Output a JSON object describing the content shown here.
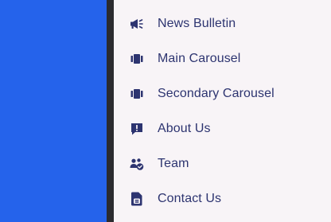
{
  "menu": {
    "items": [
      {
        "label": "News Bulletin",
        "icon": "megaphone-icon"
      },
      {
        "label": "Main Carousel",
        "icon": "carousel-icon"
      },
      {
        "label": "Secondary Carousel",
        "icon": "carousel-icon"
      },
      {
        "label": "About Us",
        "icon": "alert-message-icon"
      },
      {
        "label": "Team",
        "icon": "team-check-icon"
      },
      {
        "label": "Contact Us",
        "icon": "contact-card-icon"
      }
    ]
  },
  "colors": {
    "accent_panel": "#2563eb",
    "divider": "#2b2b2f",
    "menu_background": "#f8f4f7",
    "menu_text": "#2d3470"
  }
}
